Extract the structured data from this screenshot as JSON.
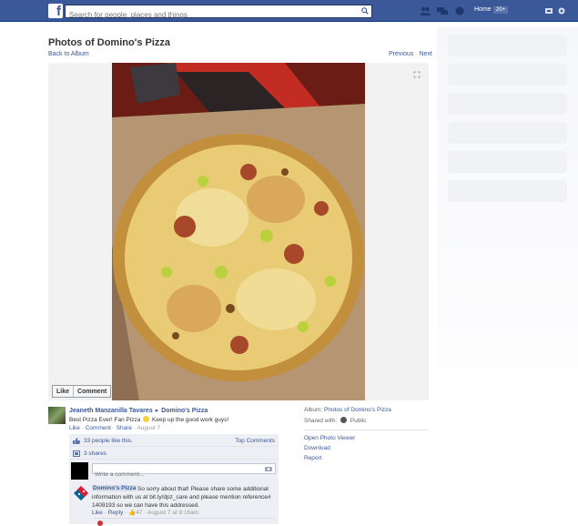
{
  "topbar": {
    "logo": "f",
    "search_placeholder": "Search for people, places and things",
    "home_label": "Home",
    "home_count": "20+"
  },
  "page": {
    "title": "Photos of Domino's Pizza",
    "back_link": "Back to Album",
    "previous": "Previous",
    "separator": "·",
    "next": "Next"
  },
  "photo": {
    "like_button": "Like",
    "comment_button": "Comment"
  },
  "post": {
    "author": "Jeaneth Manzanilla Tavares",
    "target": "Domino's Pizza",
    "caption_before": "Best Pizza Ever! Fan Pizza",
    "caption_after": "Keep up the good work guys!",
    "like": "Like",
    "comment": "Comment",
    "share": "Share",
    "time": "August 7",
    "likes_text": "33 people like this.",
    "top_comments": "Top Comments",
    "shares_text": "3 shares",
    "comment_placeholder": "Write a comment..."
  },
  "reply": {
    "author": "Domino's Pizza",
    "text": "So sorry about that! Please share some additional information with us at bit.ly/dpz_care and please mention reference# 1409193 so we can have this addressed.",
    "like": "Like",
    "reply": "Reply",
    "likes": "47",
    "time": "August 7 at 8:16am"
  },
  "side": {
    "album_label": "Album:",
    "album_name": "Photos of Domino's Pizza",
    "shared_label": "Shared with:",
    "privacy": "Public",
    "open_viewer": "Open Photo Viewer",
    "download": "Download",
    "report": "Report"
  },
  "colors": {
    "brand": "#3b5998",
    "ufi_bg": "#edeff4"
  }
}
